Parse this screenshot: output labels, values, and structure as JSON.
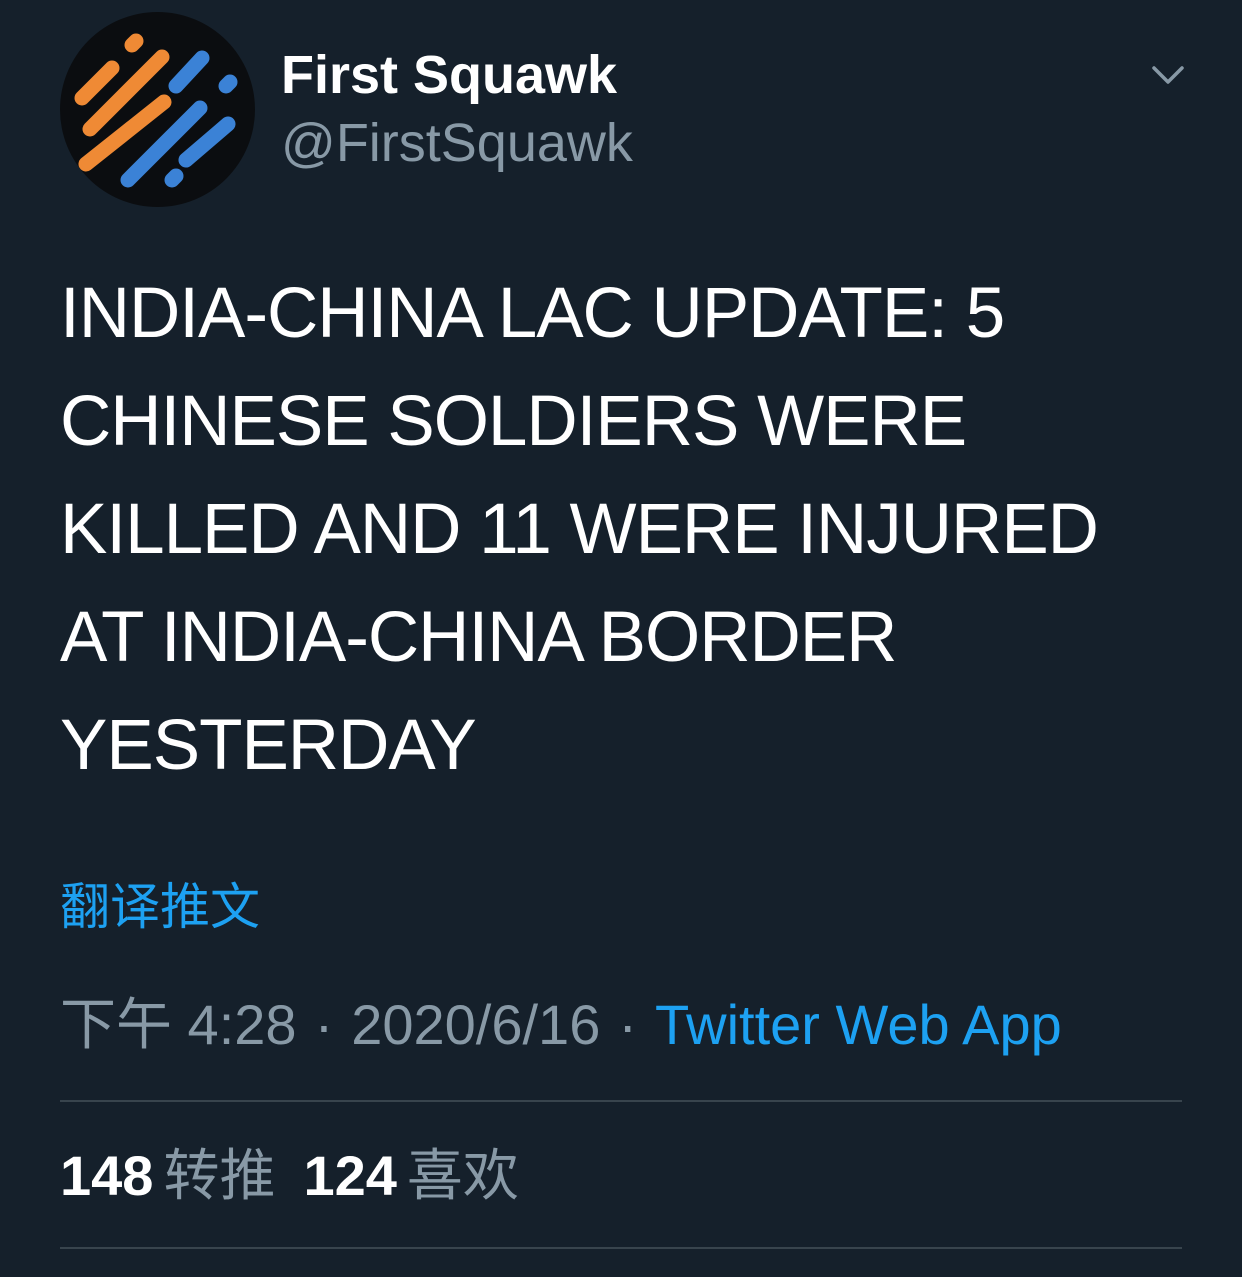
{
  "author": {
    "display_name": "First Squawk",
    "handle": "@FirstSquawk",
    "avatar_icon": "first-squawk-logo",
    "logo_colors": {
      "orange": "#ef8a35",
      "blue": "#3b82d6",
      "background": "#0b0d10"
    }
  },
  "menu_icon": "chevron-down-icon",
  "tweet": {
    "text": "INDIA-CHINA LAC UPDATE: 5\nCHINESE SOLDIERS WERE\nKILLED AND 11 WERE INJURED\nAT INDIA-CHINA BORDER\nYESTERDAY"
  },
  "translate_label": "翻译推文",
  "meta": {
    "time": "下午 4:28",
    "separator": "·",
    "date": "2020/6/16",
    "source": "Twitter Web App"
  },
  "stats": {
    "retweets_count": "148",
    "retweets_label": "转推",
    "likes_count": "124",
    "likes_label": "喜欢"
  },
  "colors": {
    "background": "#15202b",
    "text": "#ffffff",
    "secondary": "#8899a6",
    "accent": "#1da1f2",
    "divider": "#38444d"
  }
}
